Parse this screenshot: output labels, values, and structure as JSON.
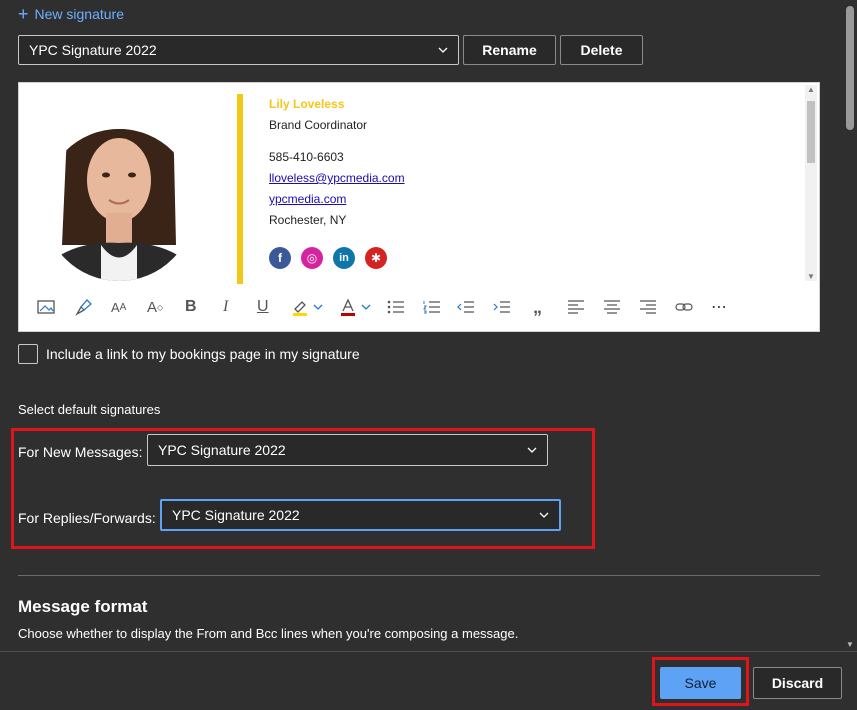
{
  "new_signature_label": "New signature",
  "signature_select": {
    "value": "YPC Signature 2022"
  },
  "buttons": {
    "rename": "Rename",
    "delete": "Delete",
    "save": "Save",
    "discard": "Discard"
  },
  "signature": {
    "name": "Lily Loveless",
    "title": "Brand Coordinator",
    "phone": "585-410-6603",
    "email": "lloveless@ypcmedia.com",
    "website": "ypcmedia.com",
    "location": "Rochester, NY",
    "social": [
      {
        "icon": "facebook-icon",
        "glyph": "f",
        "color": "#3b5998"
      },
      {
        "icon": "instagram-icon",
        "glyph": "◎",
        "color": "#d6249f"
      },
      {
        "icon": "linkedin-icon",
        "glyph": "in",
        "color": "#0e76a8"
      },
      {
        "icon": "yelp-icon",
        "glyph": "✱",
        "color": "#d32323"
      }
    ],
    "accent_color": "#f5c518"
  },
  "bookings_checkbox_label": "Include a link to my bookings page in my signature",
  "default_signatures": {
    "heading": "Select default signatures",
    "new_messages_label": "For New Messages:",
    "new_messages_value": "YPC Signature 2022",
    "replies_label": "For Replies/Forwards:",
    "replies_value": "YPC Signature 2022"
  },
  "message_format": {
    "heading": "Message format",
    "description": "Choose whether to display the From and Bcc lines when you're composing a message."
  },
  "colors": {
    "link_blue": "#6cb0ff",
    "highlight_red": "#e0151b",
    "save_blue": "#5ea2f5"
  }
}
